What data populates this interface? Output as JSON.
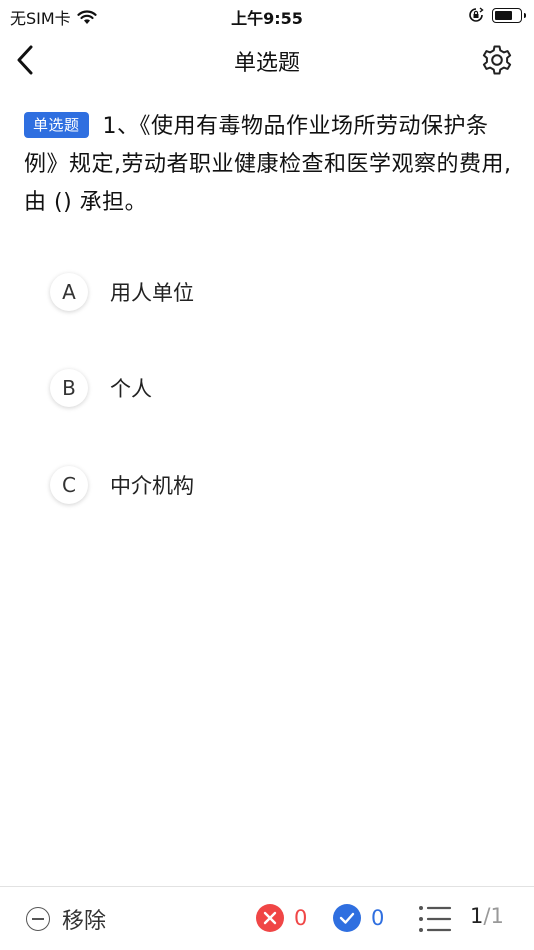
{
  "status_bar": {
    "carrier": "无SIM卡",
    "time": "上午9:55",
    "battery_level": 0.7
  },
  "nav": {
    "title": "单选题"
  },
  "question": {
    "type_badge": "单选题",
    "text": "1、《使用有毒物品作业场所劳动保护条例》规定,劳动者职业健康检查和医学观察的费用,由 () 承担。"
  },
  "options": [
    {
      "letter": "A",
      "text": "用人单位"
    },
    {
      "letter": "B",
      "text": "个人"
    },
    {
      "letter": "C",
      "text": "中介机构"
    }
  ],
  "bottom_bar": {
    "remove_label": "移除",
    "wrong_count": "0",
    "right_count": "0",
    "progress_current": "1",
    "progress_separator": "/",
    "progress_total": "1"
  },
  "colors": {
    "accent_blue": "#2f6fe0",
    "wrong_red": "#f04646"
  }
}
